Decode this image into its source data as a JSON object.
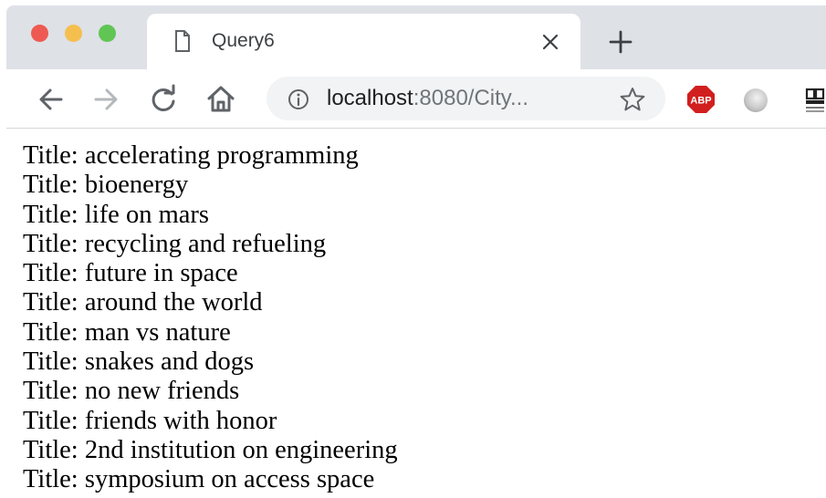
{
  "browser": {
    "tab_title": "Query6",
    "url_host": "localhost",
    "url_rest": ":8080/City...",
    "icons": {
      "page": "page-icon",
      "close": "close-icon",
      "new_tab": "plus-icon",
      "back": "arrow-left-icon",
      "forward": "arrow-right-icon",
      "reload": "reload-icon",
      "home": "home-icon",
      "info": "info-icon",
      "bookmark": "star-icon",
      "adblock": "abp-icon",
      "extension": "circle-extension-icon"
    },
    "colors": {
      "close": "#ee5a52",
      "minimize": "#f5bf4f",
      "maximize": "#61c554",
      "abp": "#d11f1f"
    }
  },
  "content": {
    "lines": [
      "Title: accelerating programming",
      "Title: bioenergy",
      "Title: life on mars",
      "Title: recycling and refueling",
      "Title: future in space",
      "Title: around the world",
      "Title: man vs nature",
      "Title: snakes and dogs",
      "Title: no new friends",
      "Title: friends with honor",
      "Title: 2nd institution on engineering",
      "Title: symposium on access space"
    ]
  }
}
